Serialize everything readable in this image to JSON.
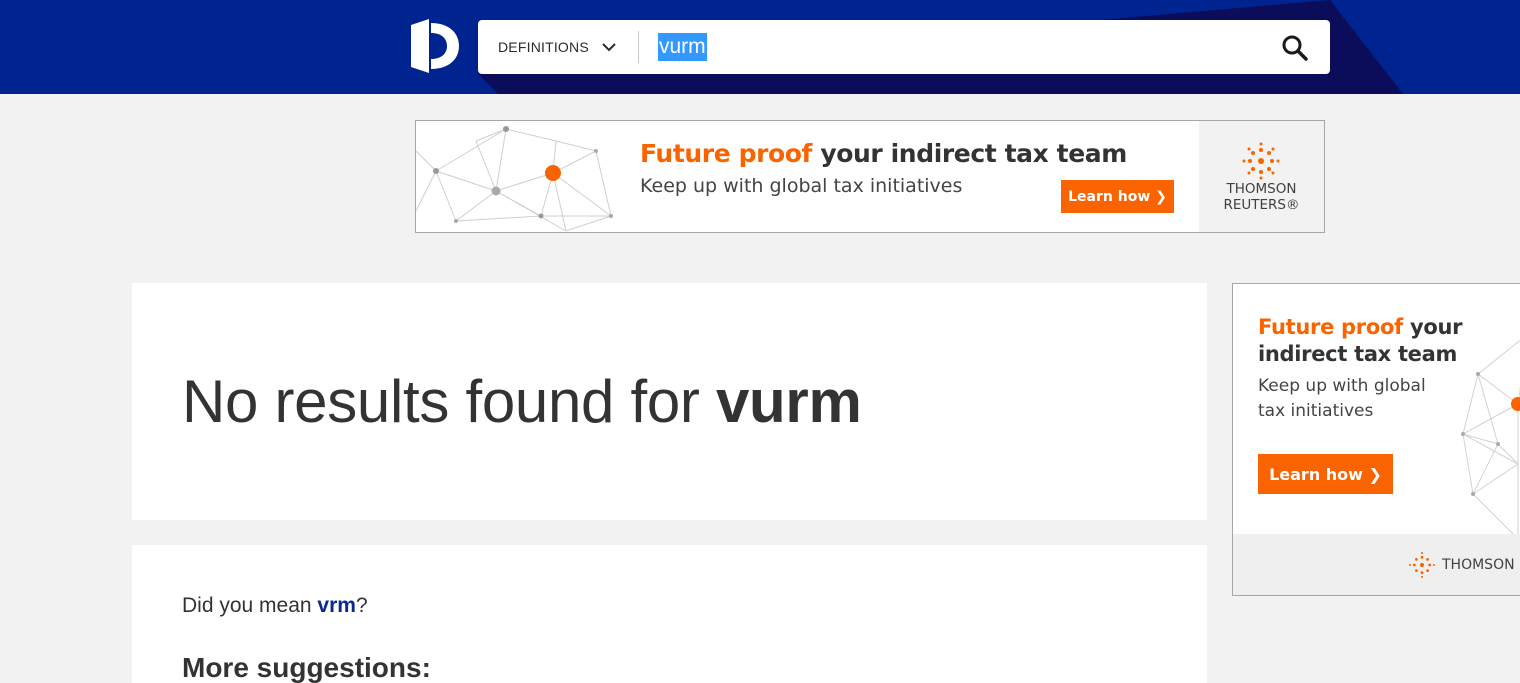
{
  "header": {
    "logo_icon": "dictionary-d-logo",
    "dropdown_label": "DEFINITIONS",
    "search_value": "vurm",
    "search_icon": "search-icon"
  },
  "top_banner": {
    "headline_highlight": "Future proof",
    "headline_rest": " your indirect tax team",
    "subline": "Keep up with global tax initiatives",
    "cta": "Learn how ❯",
    "brand_line1": "THOMSON",
    "brand_line2": "REUTERS®"
  },
  "results": {
    "no_results_prefix": "No results found for ",
    "query": "vurm",
    "did_you_mean_prefix": "Did you mean ",
    "did_you_mean_term": "vrm",
    "did_you_mean_suffix": "?",
    "more_suggestions": "More suggestions:"
  },
  "side_ad": {
    "headline_highlight": "Future proof",
    "headline_rest_1": " your",
    "headline_rest_2": "indirect tax team",
    "sub_line_1": "Keep up with global",
    "sub_line_2": "tax initiatives",
    "cta": "Learn how ❯",
    "brand": "THOMSON REUTERS"
  },
  "colors": {
    "header_blue": "#00248f",
    "header_dark": "#0c0d5a",
    "accent_orange": "#fa6400",
    "link_blue": "#0b2a85"
  }
}
